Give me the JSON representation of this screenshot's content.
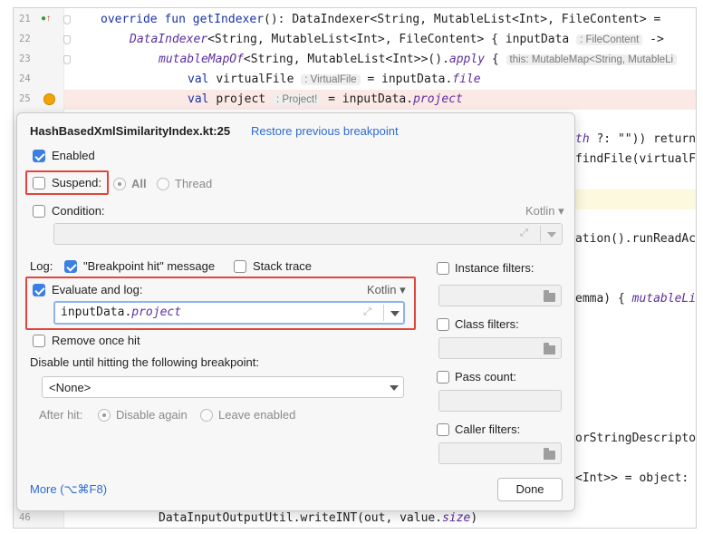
{
  "editor": {
    "line_numbers": [
      "21",
      "22",
      "23",
      "24",
      "25",
      "46"
    ],
    "lines": {
      "l21_a": "override fun ",
      "l21_b": "getIndexer",
      "l21_c": "(): DataIndexer<String, MutableList<Int>, FileContent> =",
      "l22_a": "DataIndexer",
      "l22_b": "<String, MutableList<Int>, FileContent> { inputData ",
      "l22_hint": ": FileContent",
      "l22_c": " ->",
      "l23_a": "mutableMapOf",
      "l23_b": "<String, MutableList<Int>>().",
      "l23_c": "apply",
      "l23_d": " { ",
      "l23_hint": "this: MutableMap<String, MutableLi",
      "l24_a": "val ",
      "l24_b": "virtualFile ",
      "l24_hint": ": VirtualFile",
      "l24_c": " = inputData.",
      "l24_d": "file",
      "l25_a": "val ",
      "l25_b": "project ",
      "l25_hint": ": Project!",
      "l25_c": " = inputData.",
      "l25_d": "project",
      "l46_a": "DataInputOutputUtil.writeINT(out, value.",
      "l46_b": "size",
      "l46_c": ")"
    },
    "right_fragments": {
      "r1_a": "th ",
      "r1_b": "?: \"\")) return",
      "r2": "findFile(virtualF",
      "r3": "ation().runReadAc",
      "r4_a": "emma) { ",
      "r4_b": "mutableLi",
      "r5": "orStringDescripto",
      "r6": "<Int>> = object:"
    }
  },
  "popup": {
    "title": "HashBasedXmlSimilarityIndex.kt:25",
    "restore_link": "Restore previous breakpoint",
    "enabled_label": "Enabled",
    "suspend_label": "Suspend:",
    "suspend_all": "All",
    "suspend_thread": "Thread",
    "condition_label": "Condition:",
    "condition_lang": "Kotlin",
    "log_label": "Log:",
    "bp_hit_label": "\"Breakpoint hit\" message",
    "stack_trace_label": "Stack trace",
    "eval_label": "Evaluate and log:",
    "eval_lang": "Kotlin",
    "eval_value_a": "inputData.",
    "eval_value_b": "project",
    "remove_once_label": "Remove once hit",
    "disable_until_label": "Disable until hitting the following breakpoint:",
    "disable_until_value": "<None>",
    "after_hit_label": "After hit:",
    "disable_again": "Disable again",
    "leave_enabled": "Leave enabled",
    "instance_filters": "Instance filters:",
    "class_filters": "Class filters:",
    "pass_count": "Pass count:",
    "caller_filters": "Caller filters:",
    "more_link": "More (⌥⌘F8)",
    "done_button": "Done",
    "state": {
      "enabled": true,
      "suspend": false,
      "condition": false,
      "breakpoint_hit_message": true,
      "stack_trace": false,
      "evaluate_and_log": true,
      "remove_once_hit": false,
      "instance_filters": false,
      "class_filters": false,
      "pass_count": false,
      "caller_filters": false,
      "suspend_policy": "All",
      "after_hit": "Disable again"
    }
  },
  "colors": {
    "highlight_annotation": "#e0463c",
    "link": "#2d6bd0",
    "checkbox_checked": "#3c7fe3",
    "breakpoint": "#f0a30a"
  }
}
